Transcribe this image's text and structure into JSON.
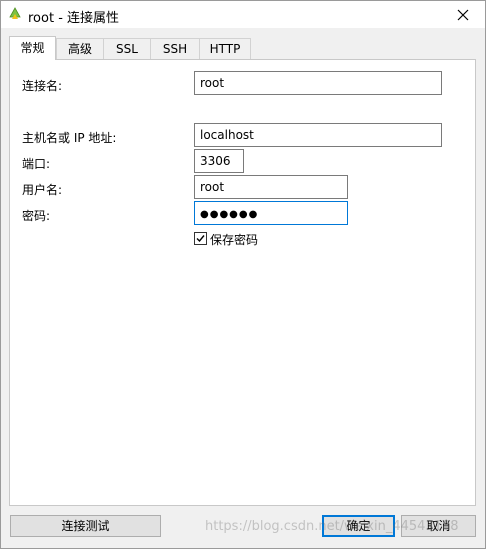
{
  "window": {
    "title": "root - 连接属性"
  },
  "tabs": [
    {
      "label": "常规",
      "active": true
    },
    {
      "label": "高级",
      "active": false
    },
    {
      "label": "SSL",
      "active": false
    },
    {
      "label": "SSH",
      "active": false
    },
    {
      "label": "HTTP",
      "active": false
    }
  ],
  "form": {
    "connection_name_label": "连接名:",
    "connection_name_value": "root",
    "host_label": "主机名或 IP 地址:",
    "host_value": "localhost",
    "port_label": "端口:",
    "port_value": "3306",
    "user_label": "用户名:",
    "user_value": "root",
    "password_label": "密码:",
    "password_value": "●●●●●●",
    "save_password_label": "保存密码",
    "save_password_checked": true
  },
  "buttons": {
    "test_connection": "连接测试",
    "ok": "确定",
    "cancel": "取消"
  },
  "watermark": "https://blog.csdn.net/weixin_44543188",
  "colors": {
    "focus_border": "#0078d7",
    "panel_bg": "#ffffff",
    "window_bg": "#f0f0f0"
  },
  "icons": {
    "app": "navicat-icon",
    "close": "close-icon",
    "check": "checkmark-icon"
  }
}
